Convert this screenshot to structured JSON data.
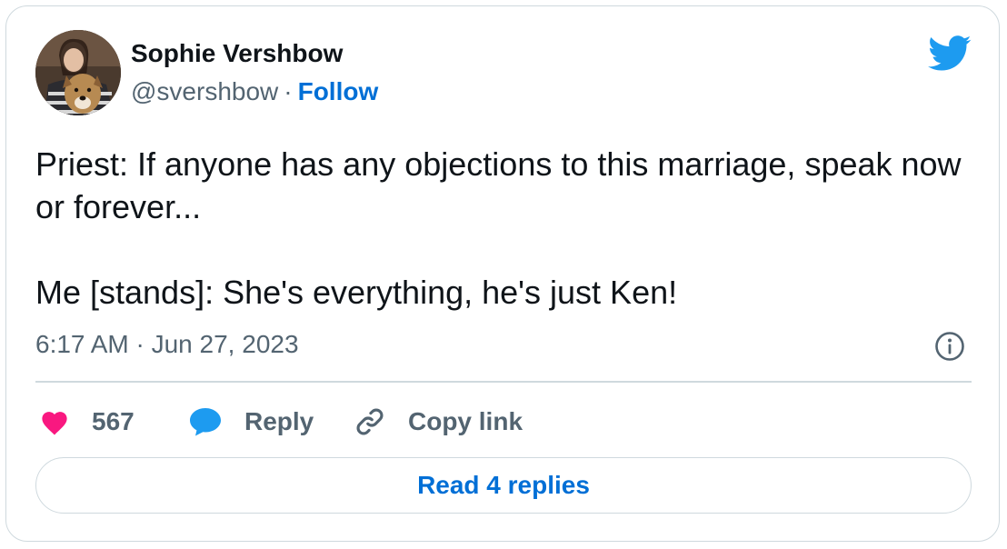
{
  "author": {
    "name": "Sophie Vershbow",
    "handle": "@svershbow",
    "separator": "·",
    "follow_label": "Follow"
  },
  "tweet": {
    "text": "Priest: If anyone has any objections to this marriage, speak now or forever...\n\nMe [stands]: She's everything, he's just Ken!",
    "timestamp": "6:17 AM · Jun 27, 2023"
  },
  "actions": {
    "like_count": "567",
    "reply_label": "Reply",
    "copy_link_label": "Copy link"
  },
  "read_replies_label": "Read 4 replies",
  "icons": {
    "brand": "twitter-bird-icon",
    "info": "info-icon",
    "like": "heart-icon",
    "reply": "speech-bubble-icon",
    "copy": "link-icon"
  },
  "colors": {
    "brand_blue": "#1d9bf0",
    "link_blue": "#006fd6",
    "heart_pink": "#f91880",
    "text_primary": "#0f1419",
    "text_secondary": "#536471",
    "border": "#cfd9de"
  }
}
